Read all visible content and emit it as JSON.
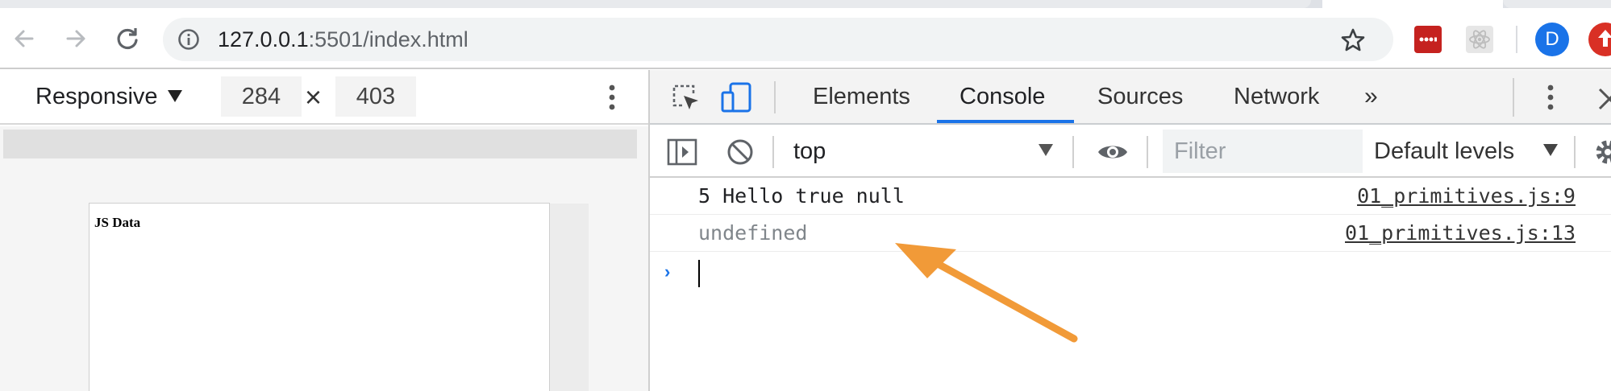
{
  "browser": {
    "url_host": "127.0.0.1",
    "url_port": ":5501",
    "url_path": "/index.html",
    "avatar_initial": "D",
    "icons": [
      "back-arrow-icon",
      "forward-arrow-icon",
      "reload-icon",
      "info-icon",
      "star-icon",
      "extension-icon",
      "react-icon",
      "profile-avatar",
      "update-icon"
    ]
  },
  "device_toolbar": {
    "mode": "Responsive",
    "width": "284",
    "times": "×",
    "height": "403"
  },
  "page_preview": {
    "heading": "JS Data"
  },
  "devtools": {
    "tabs": [
      {
        "label": "Elements"
      },
      {
        "label": "Console"
      },
      {
        "label": "Sources"
      },
      {
        "label": "Network"
      }
    ],
    "active_tab": "Console",
    "more_tabs": "»",
    "context": "top",
    "filter_placeholder": "Filter",
    "levels": "Default levels",
    "accent": "#1a73e8"
  },
  "console": {
    "messages": [
      {
        "text": "5 Hello true null",
        "source": "01_primitives.js:9"
      },
      {
        "text": "undefined",
        "source": "01_primitives.js:13"
      }
    ],
    "prompt": "›"
  },
  "annotation": {
    "arrow_color": "#f19a38"
  }
}
